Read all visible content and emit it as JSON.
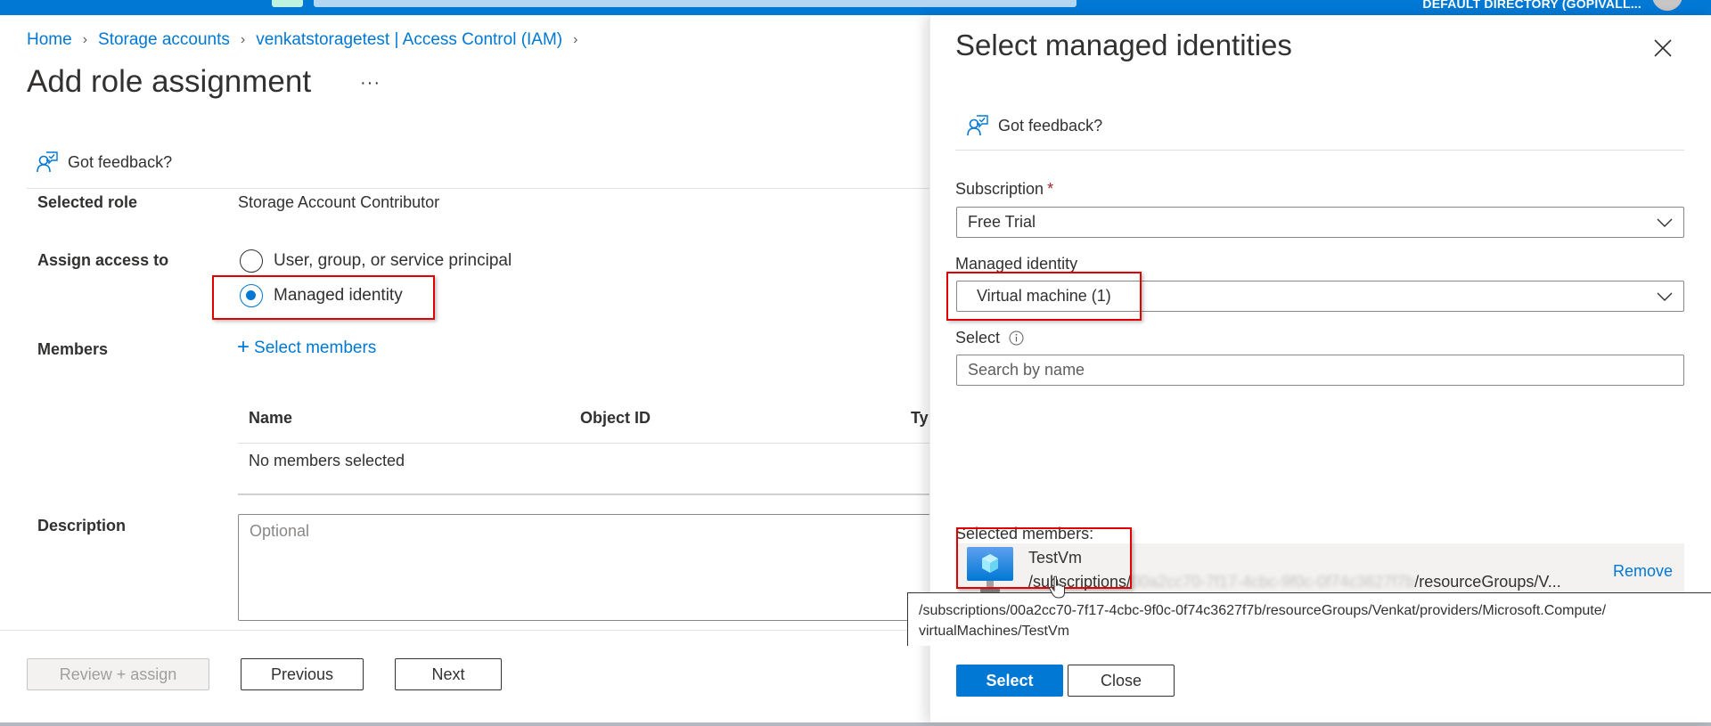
{
  "topbar": {
    "directory": "DEFAULT DIRECTORY (GOPIVALL..."
  },
  "breadcrumb": [
    {
      "label": "Home"
    },
    {
      "label": "Storage accounts"
    },
    {
      "label": "venkatstoragetest | Access Control (IAM)"
    }
  ],
  "page": {
    "title": "Add role assignment",
    "more_label": "···",
    "feedback_label": "Got feedback?"
  },
  "form": {
    "selected_role_label": "Selected role",
    "selected_role_value": "Storage Account Contributor",
    "assign_access_label": "Assign access to",
    "assign_options": [
      {
        "label": "User, group, or service principal",
        "selected": false
      },
      {
        "label": "Managed identity",
        "selected": true
      }
    ],
    "members_label": "Members",
    "select_members_label": "Select members",
    "members_table": {
      "columns": [
        "Name",
        "Object ID",
        "Ty"
      ],
      "empty_text": "No members selected"
    },
    "description_label": "Description",
    "description_placeholder": "Optional",
    "description_value": ""
  },
  "footer": {
    "review_assign": "Review + assign",
    "previous": "Previous",
    "next": "Next"
  },
  "panel": {
    "title": "Select managed identities",
    "feedback_label": "Got feedback?",
    "subscription_label": "Subscription",
    "subscription_required": "*",
    "subscription_value": "Free Trial",
    "managed_identity_label": "Managed identity",
    "managed_identity_value": "Virtual machine (1)",
    "select_label": "Select",
    "search_placeholder": "Search by name",
    "selected_members_label": "Selected members:",
    "selected_members": [
      {
        "name": "TestVm",
        "path_prefix": "/subscriptions/",
        "path_redacted": "00a2cc70-7f17-4cbc-9f0c-0f74c3627f7b",
        "path_suffix": "/resourceGroups/V...",
        "remove_label": "Remove",
        "icon": "virtual-machine-icon"
      }
    ],
    "tooltip_line1": "/subscriptions/00a2cc70-7f17-4cbc-9f0c-0f74c3627f7b/resourceGroups/Venkat/providers/Microsoft.Compute/",
    "tooltip_line2": "virtualMachines/TestVm",
    "select_button": "Select",
    "close_button": "Close"
  },
  "colors": {
    "brand": "#0078d4",
    "highlight_box": "#e00000",
    "required": "#a4262c"
  }
}
